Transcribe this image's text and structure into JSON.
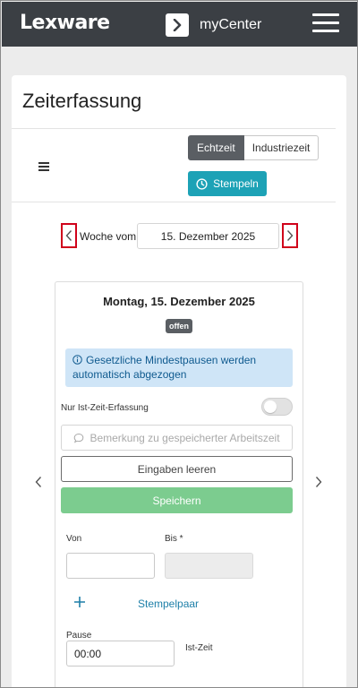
{
  "header": {
    "logo": "Lexware",
    "app_name": "myCenter"
  },
  "page": {
    "title": "Zeiterfassung"
  },
  "toolbar": {
    "tab_echtzeit": "Echtzeit",
    "tab_industriezeit": "Industriezeit",
    "stempeln_label": "Stempeln"
  },
  "week": {
    "label": "Woche vom",
    "date": "15. Dezember 2025"
  },
  "day": {
    "title": "Montag, 15. Dezember 2025",
    "status_badge": "offen",
    "info_text": "Gesetzliche Mindestpausen werden automatisch abgezogen",
    "nur_ist_zeit_label": "Nur Ist-Zeit-Erfassung",
    "nur_ist_zeit_enabled": false,
    "remark_placeholder": "Bemerkung zu gespeicherter Arbeitszeit",
    "clear_label": "Eingaben leeren",
    "save_label": "Speichern",
    "von_label": "Von",
    "bis_label": "Bis *",
    "von_value": "",
    "bis_value": "",
    "stempelpaar_label": "Stempelpaar",
    "pause_label": "Pause",
    "pause_value": "00:00",
    "ist_zeit_label": "Ist-Zeit"
  },
  "colors": {
    "topbar": "#3b3f44",
    "accent_teal": "#1da2b6",
    "save_green": "#7ccc8f",
    "info_blue_bg": "#cfe5f7",
    "highlight_red": "#d0021b"
  },
  "icons": {
    "nav_chevron": "chevron-right-icon",
    "menu": "hamburger-icon",
    "clock": "clock-icon",
    "info": "info-circle-icon",
    "comment": "comment-icon",
    "plus": "plus-icon"
  }
}
